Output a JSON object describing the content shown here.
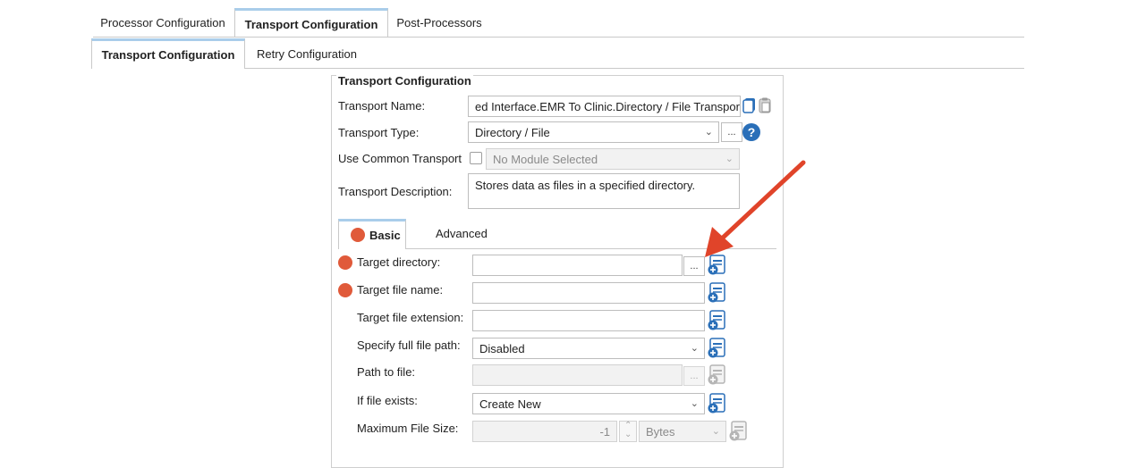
{
  "top_tabs": [
    {
      "label": "Processor Configuration"
    },
    {
      "label": "Transport Configuration"
    },
    {
      "label": "Post-Processors"
    }
  ],
  "sub_tabs": [
    {
      "label": "Transport Configuration"
    },
    {
      "label": "Retry Configuration"
    }
  ],
  "group": {
    "title": "Transport Configuration",
    "transport_name": {
      "label": "Transport Name:",
      "value": "ed Interface.EMR To Clinic.Directory / File Transport"
    },
    "transport_type": {
      "label": "Transport Type:",
      "value": "Directory / File",
      "dots": "..."
    },
    "use_common": {
      "label": "Use Common Transport",
      "value": "No Module Selected"
    },
    "description": {
      "label": "Transport Description:",
      "value": "Stores data as files in a specified directory."
    },
    "help": "?"
  },
  "inner_tabs": [
    {
      "label": "Basic"
    },
    {
      "label": "Advanced"
    }
  ],
  "fields": {
    "target_directory": {
      "label": "Target directory:",
      "value": "",
      "dots": "..."
    },
    "target_file_name": {
      "label": "Target file name:",
      "value": ""
    },
    "target_file_extension": {
      "label": "Target file extension:",
      "value": ""
    },
    "specify_full_path": {
      "label": "Specify full file path:",
      "value": "Disabled"
    },
    "path_to_file": {
      "label": "Path to file:",
      "value": "",
      "dots": "..."
    },
    "if_file_exists": {
      "label": "If file exists:",
      "value": "Create New"
    },
    "max_file_size": {
      "label": "Maximum File Size:",
      "value": "-1",
      "unit": "Bytes"
    }
  },
  "colors": {
    "required_dot": "#e05a3a",
    "accent_tab": "#a9cdea",
    "help_blue": "#2a6fb8",
    "arrow": "#e0442a"
  }
}
